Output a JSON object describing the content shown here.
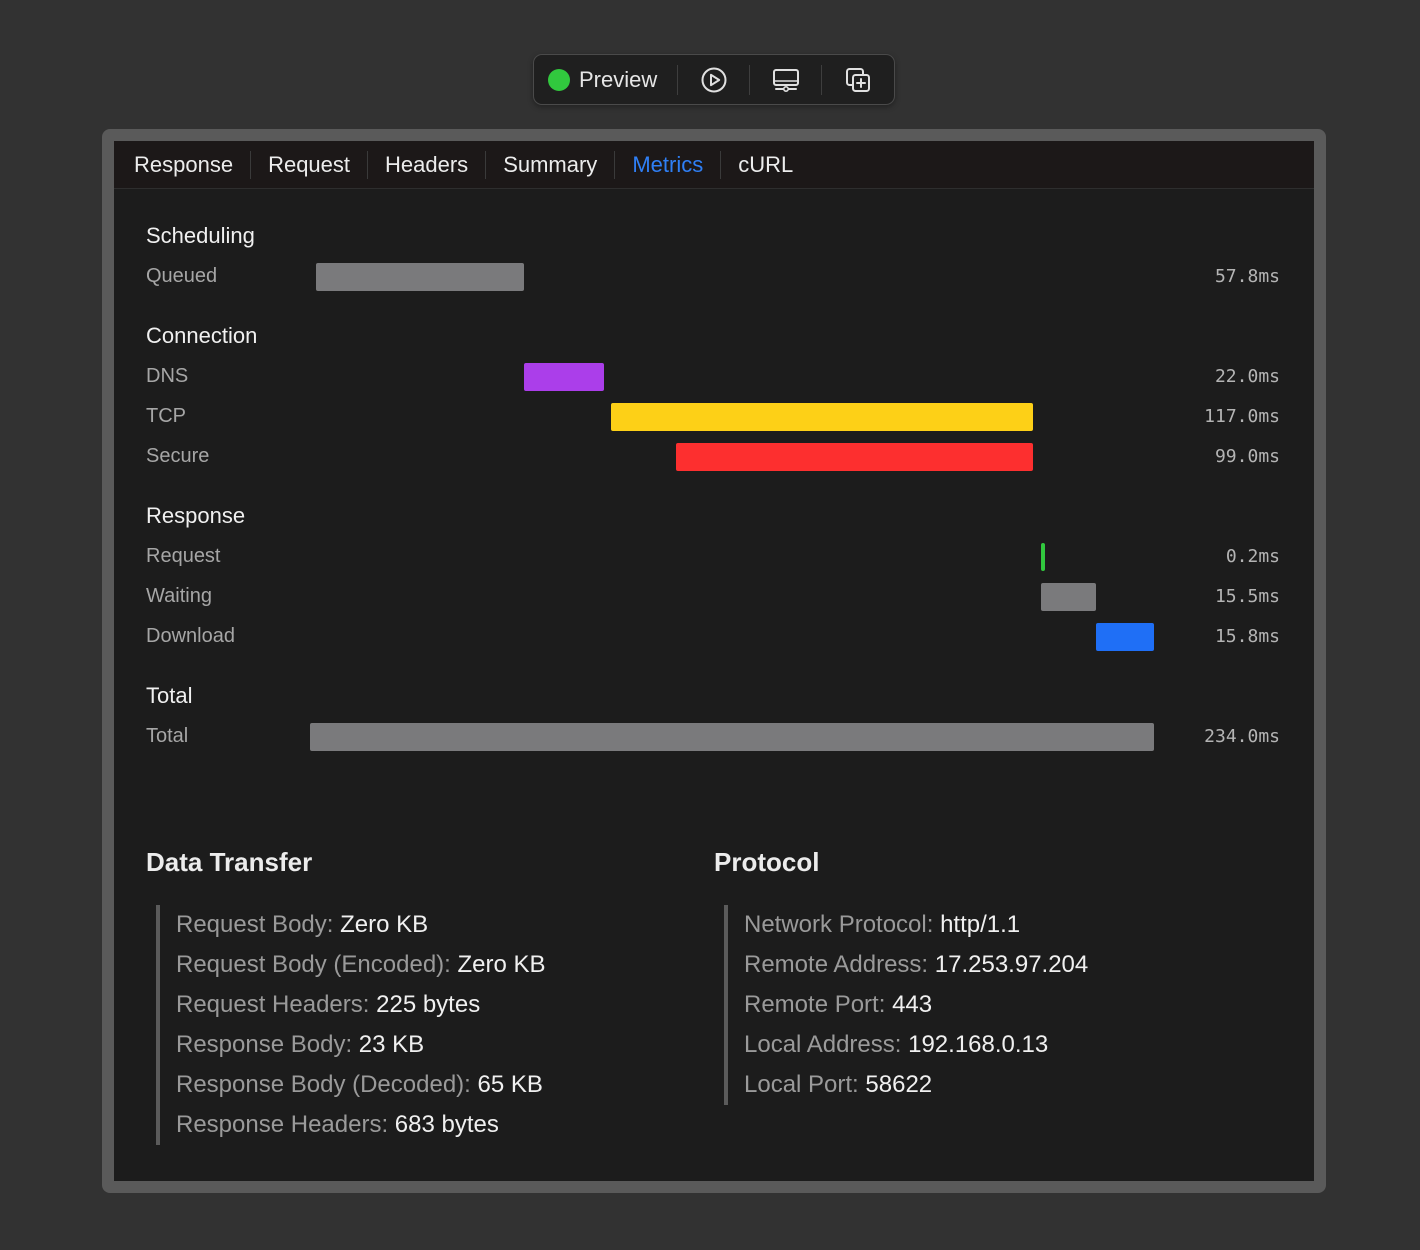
{
  "toolbar": {
    "preview_label": "Preview",
    "status_color": "#31c83e",
    "buttons": [
      "play-icon",
      "display-icon",
      "duplicate-icon"
    ]
  },
  "tabs": [
    "Response",
    "Request",
    "Headers",
    "Summary",
    "Metrics",
    "cURL"
  ],
  "active_tab": "Metrics",
  "colors": {
    "accent": "#2f7ff5",
    "queued": "#7a7a7c",
    "dns": "#ab3eea",
    "tcp": "#fdd017",
    "secure": "#fd2f2f",
    "request": "#31c83e",
    "waiting": "#7a7a7c",
    "download": "#1f6ff6",
    "total": "#7a7a7c"
  },
  "metrics": {
    "scheduling": {
      "title": "Scheduling",
      "queued": {
        "label": "Queued",
        "value": "57.8ms"
      }
    },
    "connection": {
      "title": "Connection",
      "dns": {
        "label": "DNS",
        "value": "22.0ms"
      },
      "tcp": {
        "label": "TCP",
        "value": "117.0ms"
      },
      "secure": {
        "label": "Secure",
        "value": "99.0ms"
      }
    },
    "response": {
      "title": "Response",
      "request": {
        "label": "Request",
        "value": "0.2ms"
      },
      "waiting": {
        "label": "Waiting",
        "value": "15.5ms"
      },
      "download": {
        "label": "Download",
        "value": "15.8ms"
      }
    },
    "total": {
      "title": "Total",
      "total": {
        "label": "Total",
        "value": "234.0ms"
      }
    }
  },
  "data_transfer": {
    "title": "Data Transfer",
    "items": [
      {
        "key": "Request Body:",
        "value": "Zero KB"
      },
      {
        "key": "Request Body (Encoded):",
        "value": "Zero KB"
      },
      {
        "key": "Request Headers:",
        "value": "225 bytes"
      },
      {
        "key": "Response Body:",
        "value": "23 KB"
      },
      {
        "key": "Response Body (Decoded):",
        "value": "65 KB"
      },
      {
        "key": "Response Headers:",
        "value": "683 bytes"
      }
    ]
  },
  "protocol": {
    "title": "Protocol",
    "items": [
      {
        "key": "Network Protocol:",
        "value": "http/1.1"
      },
      {
        "key": "Remote Address:",
        "value": "17.253.97.204"
      },
      {
        "key": "Remote Port:",
        "value": "443"
      },
      {
        "key": "Local Address:",
        "value": "192.168.0.13"
      },
      {
        "key": "Local Port:",
        "value": "58622"
      }
    ]
  }
}
